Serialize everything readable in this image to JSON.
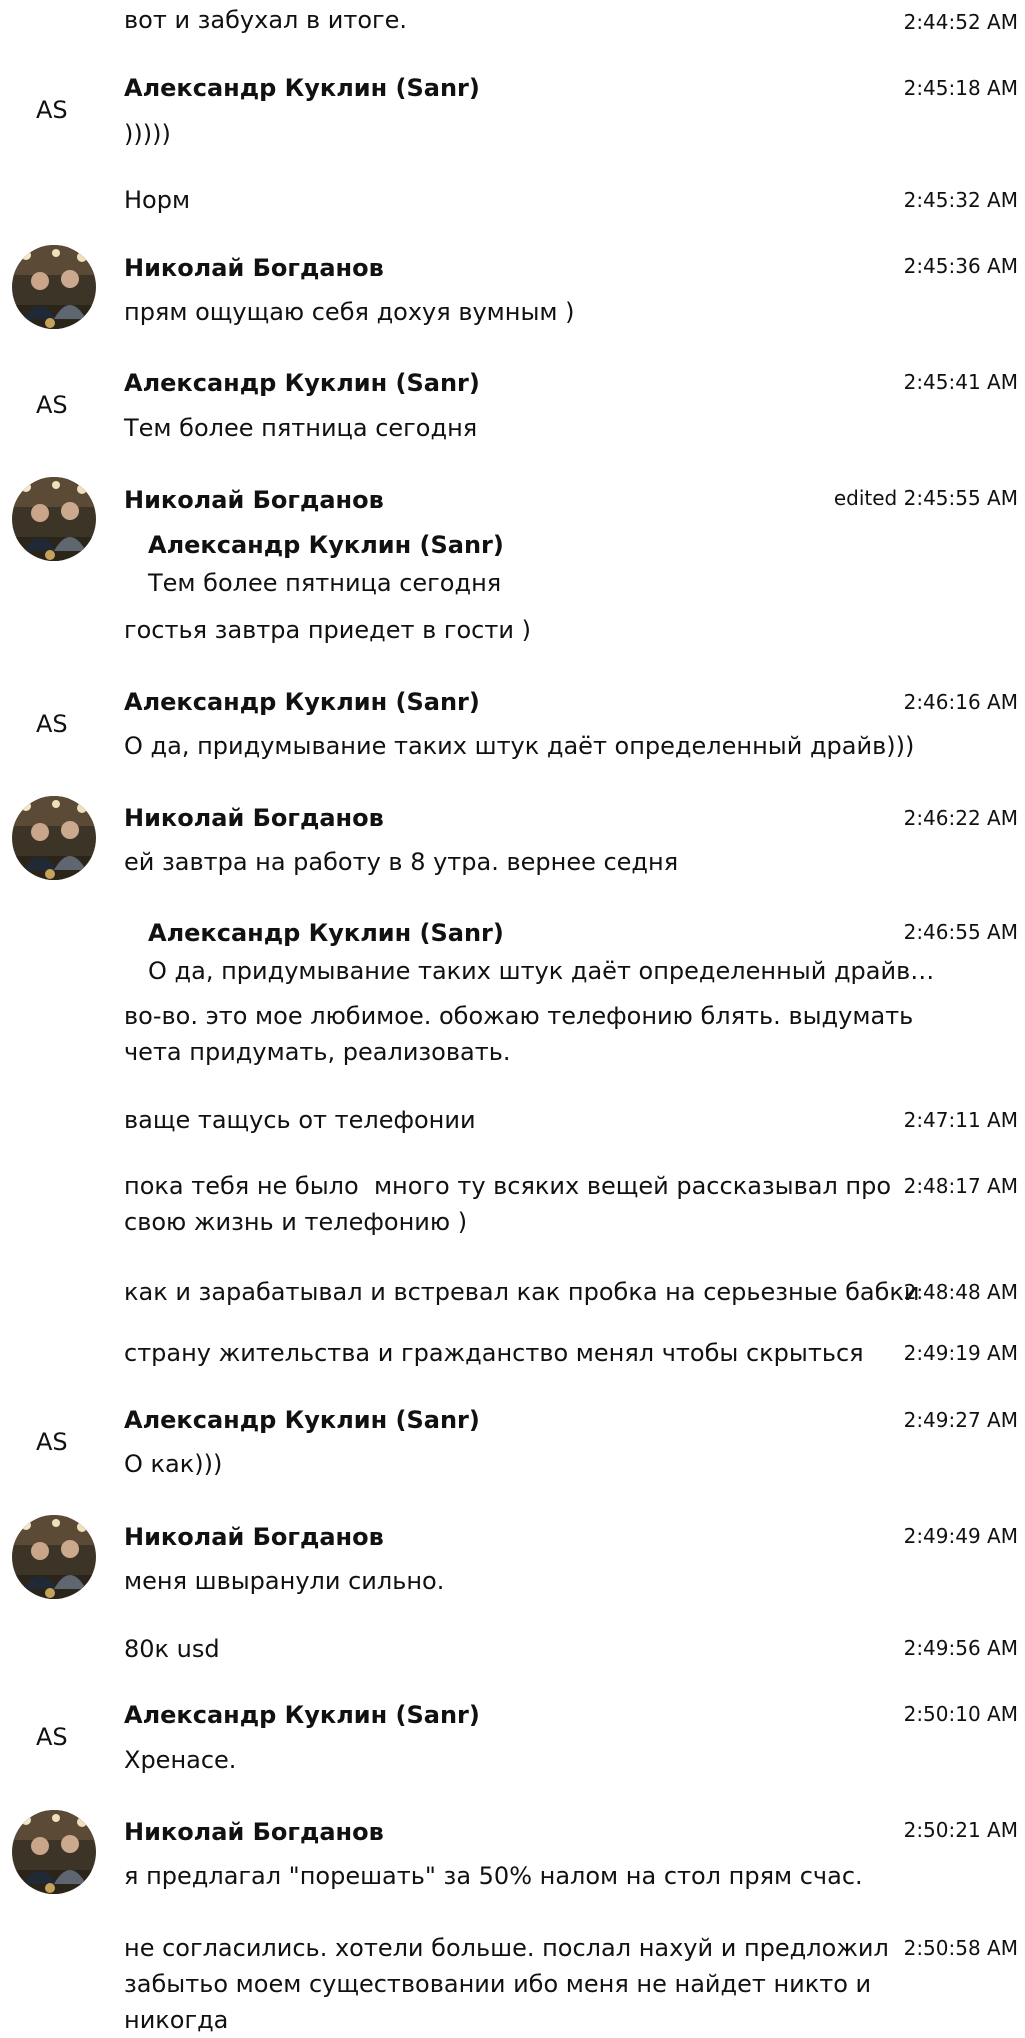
{
  "messages": [
    {
      "text": "вот и забухал в итоге.",
      "time": "2:44:52 AM"
    },
    {
      "author": "Александр Куклин (Sanr)",
      "avatar_text": "AS",
      "time": "2:45:18 AM",
      "text": ")))))"
    },
    {
      "text": "Норм",
      "time": "2:45:32 AM"
    },
    {
      "author": "Николай Богданов",
      "time": "2:45:36 AM",
      "text": "прям ощущаю себя дохуя вумным )"
    },
    {
      "author": "Александр Куклин (Sanr)",
      "avatar_text": "AS",
      "time": "2:45:41 AM",
      "text": "Тем более пятница сегодня"
    },
    {
      "author": "Николай Богданов",
      "time": "edited 2:45:55 AM",
      "quote_author": "Александр Куклин (Sanr)",
      "quote_text": "Тем более пятница сегодня",
      "text": "гостья завтра приедет в гости )"
    },
    {
      "author": "Александр Куклин (Sanr)",
      "avatar_text": "AS",
      "time": "2:46:16 AM",
      "text": "О да, придумывание таких штук даёт определенный драйв)))"
    },
    {
      "author": "Николай Богданов",
      "time": "2:46:22 AM",
      "text": "ей завтра на работу в 8 утра. вернее седня"
    },
    {
      "time": "2:46:55 AM",
      "quote_author": "Александр Куклин (Sanr)",
      "quote_text": "О да, придумывание таких штук даёт определенный драйв…",
      "text": "во-во. это мое любимое. обожаю телефонию блять. выдумать\nчета придумать, реализовать."
    },
    {
      "text": "ваще тащусь от телефонии",
      "time": "2:47:11 AM"
    },
    {
      "text": "пока тебя не было  много ту всяких вещей рассказывал про\nсвою жизнь и телефонию )",
      "time": "2:48:17 AM"
    },
    {
      "text": "как и зарабатывал и встревал как пробка на серьезные бабки",
      "time": "2:48:48 AM"
    },
    {
      "text": "страну жительства и гражданство менял чтобы скрыться",
      "time": "2:49:19 AM"
    },
    {
      "author": "Александр Куклин (Sanr)",
      "avatar_text": "AS",
      "time": "2:49:27 AM",
      "text": "О как)))"
    },
    {
      "author": "Николай Богданов",
      "time": "2:49:49 AM",
      "text": "меня швыранули сильно."
    },
    {
      "text": "80к usd",
      "time": "2:49:56 AM"
    },
    {
      "author": "Александр Куклин (Sanr)",
      "avatar_text": "AS",
      "time": "2:50:10 AM",
      "text": "Хренасе."
    },
    {
      "author": "Николай Богданов",
      "time": "2:50:21 AM",
      "text": "я предлагал \"порешать\" за 50% налом на стол прям счас."
    },
    {
      "text": "не согласились. хотели больше. послал нахуй и предложил\nзабытьо моем существовании ибо меня не найдет никто и\nникогда",
      "time": "2:50:58 AM"
    }
  ]
}
